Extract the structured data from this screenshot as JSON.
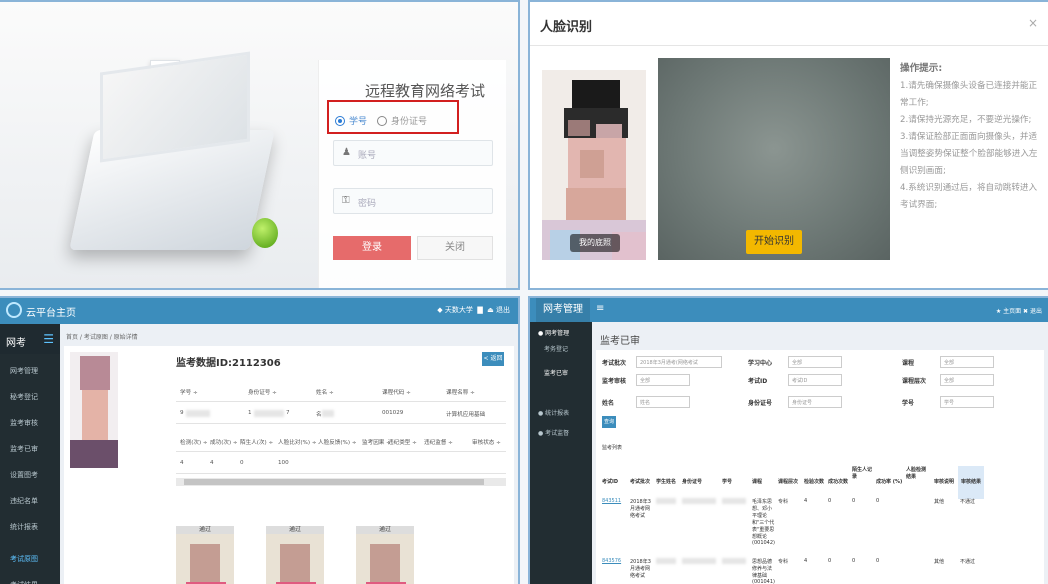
{
  "login": {
    "title": "远程教育网络考试",
    "radio_student": "学号",
    "radio_idcard": "身份证号",
    "account_placeholder": "账号",
    "password_placeholder": "密码",
    "login_btn": "登录",
    "close_btn": "关闭"
  },
  "face": {
    "title": "人脸识别",
    "close": "×",
    "my_photo": "我的底照",
    "start_btn": "开始识别",
    "tips_title": "操作提示:",
    "tips": [
      "1.请先确保摄像头设备已连接并能正常工作;",
      "2.请保持光源充足，不要逆光操作;",
      "3.请保证脸部正面面向摄像头，并适当调整姿势保证整个脸部能够进入左侧识别画面;",
      "4.系统识别通过后，将自动跳转进入考试界面;"
    ]
  },
  "monitor": {
    "brand": "云平台主页",
    "top_right": "◆ 天数大学",
    "exit": "⏏ 退出",
    "side_head": "网考",
    "side_items": [
      "网考管理",
      "秘考登记",
      "监考审核",
      "监考已审",
      "设置图考",
      "违纪名单",
      "统计报表",
      "考试原图",
      "考试结果"
    ],
    "crumb": "首页 / 考试原图 / 原始详情",
    "monitor_id": "监考数据ID:2112306",
    "back_btn": "< 返回",
    "row1_headers": [
      "学号 ÷",
      "身份证号 ÷",
      "姓名 ÷",
      "课程代码 ÷",
      "课程名称 ÷"
    ],
    "row1_values": [
      "9",
      "1",
      "7",
      "名",
      "001029",
      "计算机应用基础"
    ],
    "row2_headers": [
      "检测(次) ÷",
      "成功(次) ÷",
      "陌生人(次) ÷",
      "人脸比对(%) ÷",
      "人脸反馈(%) ÷",
      "监考因果 ÷",
      "违纪类型 ÷",
      "违纪监督 ÷",
      "审核状态 ÷"
    ],
    "row2_values": [
      "4",
      "4",
      "0",
      "100"
    ],
    "thumb_label": "通过"
  },
  "review": {
    "brand": "网考管理",
    "menu_icon": "≡",
    "top_right": "★ 主页面 ✖ 退出",
    "side_items": [
      "● 网考管理",
      "考务登记",
      "监考已审",
      "● 统计报表",
      "● 考试监督"
    ],
    "title": "监考已审",
    "form": {
      "exam_batch_label": "考试批次",
      "exam_batch_value": "2018年3月通考(网络考试",
      "center_label": "学习中心",
      "center_value": "全部",
      "course_label": "课程",
      "course_value": "全部",
      "status_label": "监考审核",
      "status_value": "全部",
      "exam_id_label": "考试ID",
      "exam_id_ph": "考试ID",
      "level_label": "课程层次",
      "level_value": "全部",
      "name_label": "姓名",
      "name_ph": "姓名",
      "idcard_label": "身份证号",
      "idcard_ph": "身份证号",
      "stuno_label": "学号",
      "stuno_ph": "学号",
      "query_btn": "查询"
    },
    "list_title": "监考列表",
    "headers": [
      "考试ID",
      "考试批次",
      "学生姓名",
      "身份证号",
      "学号",
      "课程",
      "课程层次",
      "检验次数",
      "成功次数",
      "陌生人记录",
      "成功率 (%)",
      "人脸检测结果",
      "审核说明",
      "审核结果"
    ],
    "rows": [
      {
        "id": "843511",
        "batch": "2018年3月通考网络考试",
        "course": "毛泽东思想、邓小平理论和\"三个代表\"重要思想概论(001042)",
        "level": "专科",
        "checks": "4",
        "success": "0",
        "stranger": "0",
        "rate": "0",
        "note": "其他",
        "result": "不通过"
      },
      {
        "id": "843576",
        "batch": "2018年3月通考网络考试",
        "course": "思想品德修养与法律基础(001041)",
        "level": "专科",
        "checks": "4",
        "success": "0",
        "stranger": "0",
        "rate": "0",
        "note": "其他",
        "result": "不通过"
      }
    ]
  }
}
